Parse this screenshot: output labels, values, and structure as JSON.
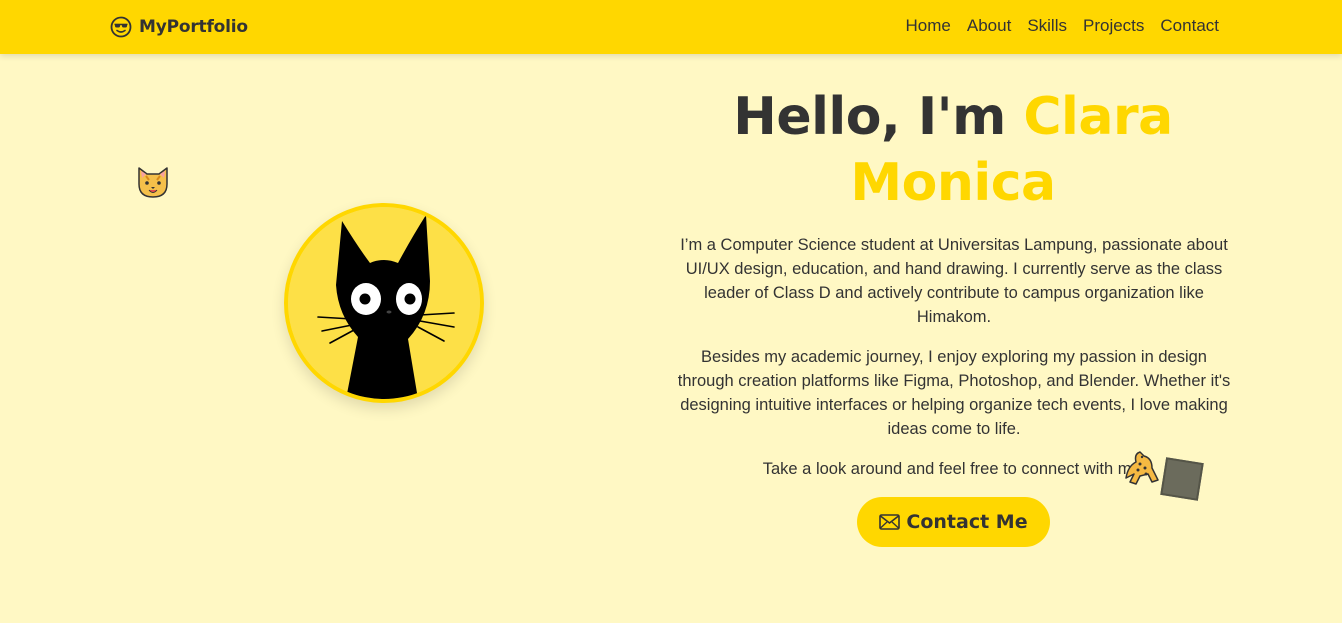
{
  "colors": {
    "accent": "#ffd700",
    "background": "#fff8c4",
    "text": "#333333"
  },
  "nav": {
    "brand_icon": "smiling-face-with-sunglasses-icon",
    "brand": "MyPortfolio",
    "links": [
      "Home",
      "About",
      "Skills",
      "Projects",
      "Contact"
    ]
  },
  "hero": {
    "title_prefix": "Hello, I'm",
    "title_name": "Clara Monica",
    "avatar": "black-cat-illustration",
    "paragraphs": [
      "I’m a Computer Science student at Universitas Lampung, passionate about UI/UX design, education, and hand drawing. I currently serve as the class leader of Class D and actively contribute to campus organization like Himakom.",
      "Besides my academic journey, I enjoy exploring my passion in design through creation platforms like Figma, Photoshop, and Blender. Whether it's designing intuitive interfaces or helping organize tech events, I love making ideas come to life.",
      "Take a look around and feel free to connect with me!"
    ],
    "cta_icon": "envelope-icon",
    "cta_label": "Contact Me"
  },
  "decorations": [
    "cat-face-emoji",
    "leopard-emoji",
    "gray-square"
  ]
}
